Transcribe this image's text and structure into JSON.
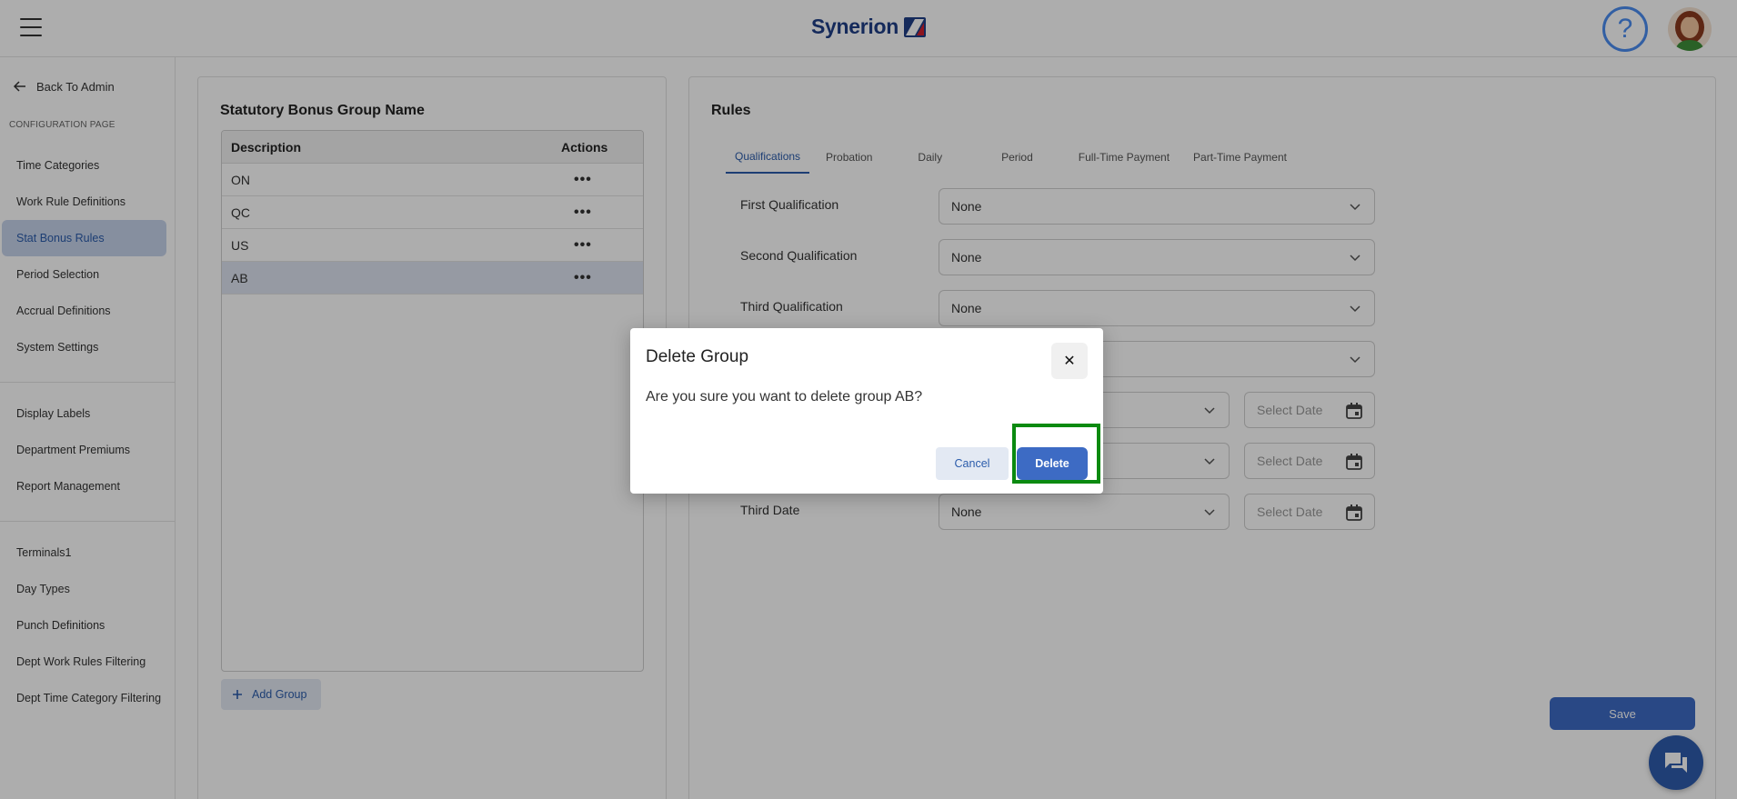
{
  "header": {
    "brand": "Synerion",
    "help_symbol": "?",
    "brand_color": "#1f3f86",
    "help_color": "#4a8cf0"
  },
  "sidebar": {
    "back_label": "Back To Admin",
    "section_label": "CONFIGURATION PAGE",
    "group1": [
      {
        "label": "Time Categories"
      },
      {
        "label": "Work Rule Definitions"
      },
      {
        "label": "Stat Bonus Rules",
        "active": true
      },
      {
        "label": "Period Selection"
      },
      {
        "label": "Accrual Definitions"
      },
      {
        "label": "System Settings"
      }
    ],
    "group2": [
      {
        "label": "Display Labels"
      },
      {
        "label": "Department Premiums"
      },
      {
        "label": "Report Management"
      }
    ],
    "group3": [
      {
        "label": "Terminals1"
      },
      {
        "label": "Day Types"
      },
      {
        "label": "Punch Definitions"
      },
      {
        "label": "Dept Work Rules Filtering"
      },
      {
        "label": "Dept Time Category Filtering"
      }
    ],
    "active_color": "#2b5cab"
  },
  "groups_panel": {
    "title": "Statutory Bonus Group Name",
    "columns": {
      "description": "Description",
      "actions": "Actions"
    },
    "rows": [
      {
        "description": "ON",
        "actions": "•••"
      },
      {
        "description": "QC",
        "actions": "•••"
      },
      {
        "description": "US",
        "actions": "•••"
      },
      {
        "description": "AB",
        "actions": "•••",
        "selected": true
      }
    ],
    "add_button": "Add Group"
  },
  "rules_panel": {
    "title": "Rules",
    "tabs": [
      {
        "label": "Qualifications",
        "active": true
      },
      {
        "label": "Probation"
      },
      {
        "label": "Daily"
      },
      {
        "label": "Period"
      },
      {
        "label": "Full-Time Payment"
      },
      {
        "label": "Part-Time Payment"
      }
    ],
    "fields": {
      "first_qualification": {
        "label": "First Qualification",
        "value": "None"
      },
      "second_qualification": {
        "label": "Second Qualification",
        "value": "None"
      },
      "third_qualification": {
        "label": "Third Qualification",
        "value": "None"
      },
      "fourth_select": {
        "value": ""
      },
      "first_date": {
        "value": "",
        "date_placeholder": "Select Date"
      },
      "second_date": {
        "value": "",
        "date_placeholder": "Select Date"
      },
      "third_date": {
        "label": "Third Date",
        "value": "None",
        "date_placeholder": "Select Date"
      }
    },
    "save_button": "Save"
  },
  "dialog": {
    "title": "Delete Group",
    "close_symbol": "✕",
    "message": "Are you sure you want to delete group AB?",
    "cancel_button": "Cancel",
    "delete_button": "Delete",
    "highlight_color": "#0a8a10",
    "primary_color": "#3d6bc4"
  }
}
